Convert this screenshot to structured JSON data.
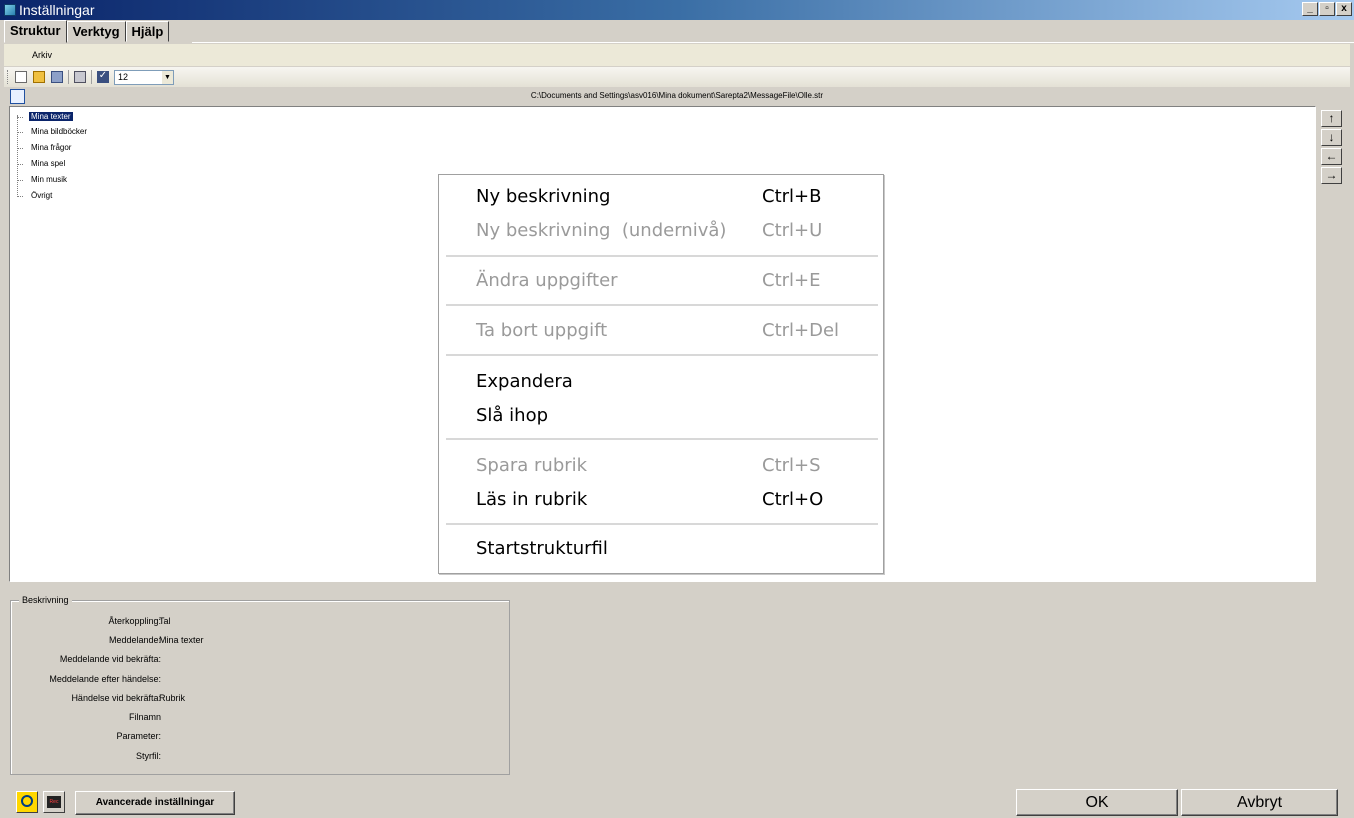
{
  "window": {
    "title": "Inställningar",
    "buttons": {
      "minimize": "_",
      "restore": "̅",
      "close": "x"
    }
  },
  "tabs": [
    "Struktur",
    "Verktyg",
    "Hjälp"
  ],
  "menubar": {
    "arkiv": "Arkiv"
  },
  "toolbar": {
    "icons": [
      "new-file-icon",
      "open-folder-icon",
      "save-icon",
      "print-icon",
      "checkbox-icon"
    ],
    "font_size_value": "12"
  },
  "path": "C:\\Documents and Settings\\asv016\\Mina dokument\\Sarepta2\\MessageFile\\Olle.str",
  "tree": {
    "items": [
      "Mina texter",
      "Mina bildböcker",
      "Mina frågor",
      "Mina spel",
      "Min musik",
      "Övrigt"
    ],
    "selected": "Mina texter"
  },
  "nav_buttons": [
    "↑",
    "↓",
    "←",
    "→"
  ],
  "context_menu": {
    "items": [
      {
        "label": "Ny beskrivning",
        "shortcut": "Ctrl+B",
        "enabled": true
      },
      {
        "label": "Ny beskrivning  (undernivå)",
        "shortcut": "Ctrl+U",
        "enabled": false
      },
      {
        "label": "Ändra uppgifter",
        "shortcut": "Ctrl+E",
        "enabled": false
      },
      {
        "label": "Ta bort uppgift",
        "shortcut": "Ctrl+Del",
        "enabled": false
      },
      {
        "label": "Expandera",
        "shortcut": "",
        "enabled": true
      },
      {
        "label": "Slå ihop",
        "shortcut": "",
        "enabled": true
      },
      {
        "label": "Spara rubrik",
        "shortcut": "Ctrl+S",
        "enabled": false
      },
      {
        "label": "Läs in rubrik",
        "shortcut": "Ctrl+O",
        "enabled": true
      },
      {
        "label": "Startstrukturfil",
        "shortcut": "",
        "enabled": true
      }
    ]
  },
  "description": {
    "legend": "Beskrivning",
    "rows": [
      {
        "label": "Återkoppling:",
        "value": "Tal"
      },
      {
        "label": "Meddelande:",
        "value": "Mina texter"
      },
      {
        "label": "Meddelande vid bekräfta:",
        "value": ""
      },
      {
        "label": "Meddelande efter händelse:",
        "value": ""
      },
      {
        "label": "Händelse vid bekräfta:",
        "value": "Rubrik"
      },
      {
        "label": "Filnamn",
        "value": ""
      },
      {
        "label": "Parameter:",
        "value": ""
      },
      {
        "label": "Styrfil:",
        "value": ""
      }
    ]
  },
  "footer": {
    "rec_label": "Rec",
    "advanced_button": "Avancerade inställningar",
    "ok_button": "OK",
    "cancel_button": "Avbryt"
  }
}
